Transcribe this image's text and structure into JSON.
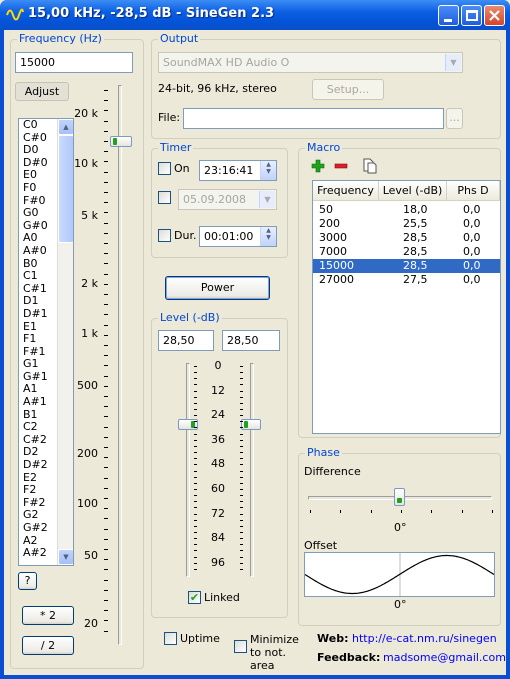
{
  "window": {
    "title": "15,00 kHz, -28,5 dB - SineGen 2.3"
  },
  "frequency": {
    "group_label": "Frequency (Hz)",
    "value": "15000",
    "adjust_label": "Adjust",
    "notes": [
      "C0",
      "C#0",
      "D0",
      "D#0",
      "E0",
      "F0",
      "F#0",
      "G0",
      "G#0",
      "A0",
      "A#0",
      "B0",
      "C1",
      "C#1",
      "D1",
      "D#1",
      "E1",
      "F1",
      "F#1",
      "G1",
      "G#1",
      "A1",
      "A#1",
      "B1",
      "C2",
      "C#2",
      "D2",
      "D#2",
      "E2",
      "F2",
      "F#2",
      "G2",
      "G#2",
      "A2",
      "A#2"
    ],
    "help_label": "?",
    "double_label": "* 2",
    "half_label": "/ 2",
    "scale": [
      "20 k",
      "10 k",
      "5 k",
      "2 k",
      "1 k",
      "500",
      "200",
      "100",
      "50",
      "20"
    ]
  },
  "output": {
    "group_label": "Output",
    "device": "SoundMAX HD Audio O",
    "format": "24-bit, 96 kHz, stereo",
    "setup_label": "Setup...",
    "file_label": "File:",
    "file_value": "",
    "browse_label": "..."
  },
  "timer": {
    "group_label": "Timer",
    "on_label": "On",
    "on_time": "23:16:41",
    "date": "05.09.2008",
    "dur_label": "Dur.",
    "duration": "00:01:00"
  },
  "power_label": "Power",
  "level": {
    "group_label": "Level (-dB)",
    "left": "28,50",
    "right": "28,50",
    "scale": [
      "0",
      "12",
      "24",
      "36",
      "48",
      "60",
      "72",
      "84",
      "96"
    ],
    "linked_label": "Linked",
    "linked": true
  },
  "macro": {
    "group_label": "Macro",
    "columns": [
      "Frequency",
      "Level (-dB)",
      "Phs D"
    ],
    "rows": [
      [
        "50",
        "18,0",
        "0,0"
      ],
      [
        "200",
        "25,5",
        "0,0"
      ],
      [
        "3000",
        "28,5",
        "0,0"
      ],
      [
        "7000",
        "28,5",
        "0,0"
      ],
      [
        "15000",
        "28,5",
        "0,0"
      ],
      [
        "27000",
        "27,5",
        "0,0"
      ]
    ],
    "selected_index": 4
  },
  "phase": {
    "group_label": "Phase",
    "difference_label": "Difference",
    "difference_value": "0°",
    "offset_label": "Offset",
    "offset_value": "0°"
  },
  "footer": {
    "uptime_label": "Uptime",
    "minimize_label": "Minimize to not. area",
    "web_label": "Web:",
    "web_url": "http://e-cat.nm.ru/sinegen",
    "feedback_label": "Feedback:",
    "feedback_email": "madsome@gmail.com"
  },
  "colors": {
    "titlebar": "#0454d8",
    "group_label": "#0046d5",
    "selection": "#316ac5",
    "accent_green": "#21a121"
  }
}
